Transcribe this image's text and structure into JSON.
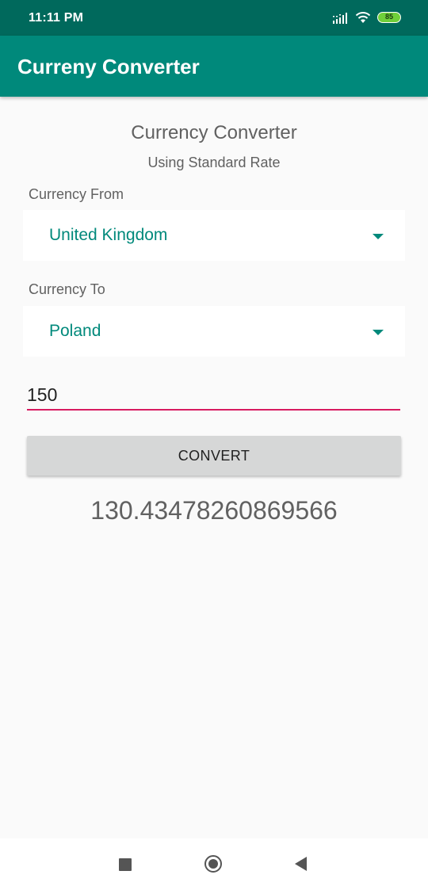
{
  "status_bar": {
    "time": "11:11 PM",
    "battery_level": "85",
    "icons": [
      "signal-icon",
      "wifi-icon",
      "battery-icon"
    ]
  },
  "app_bar": {
    "title": "Curreny Converter",
    "color": "#00897b"
  },
  "header": {
    "title": "Currency Converter",
    "subtitle": "Using Standard Rate"
  },
  "form": {
    "from_label": "Currency From",
    "from_value": "United Kingdom",
    "to_label": "Currency To",
    "to_value": "Poland",
    "amount_value": "150",
    "convert_label": "CONVERT",
    "accent_color": "#d81b60"
  },
  "result": {
    "value": "130.43478260869566"
  },
  "nav_bar": {
    "icons": [
      "recents-icon",
      "home-icon",
      "back-icon"
    ]
  }
}
